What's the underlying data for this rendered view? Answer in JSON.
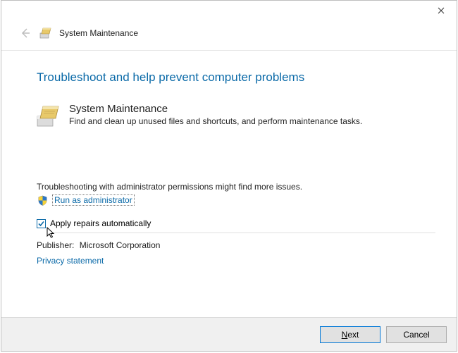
{
  "window": {
    "title": "System Maintenance"
  },
  "page": {
    "heading": "Troubleshoot and help prevent computer problems"
  },
  "troubleshooter": {
    "name": "System Maintenance",
    "description": "Find and clean up unused files and shortcuts, and perform maintenance tasks."
  },
  "admin": {
    "note": "Troubleshooting with administrator permissions might find more issues.",
    "link": "Run as administrator"
  },
  "options": {
    "apply_label": "Apply repairs automatically",
    "apply_checked": true
  },
  "meta": {
    "publisher_label": "Publisher:",
    "publisher_value": "Microsoft Corporation",
    "privacy": "Privacy statement"
  },
  "buttons": {
    "next_prefix": "N",
    "next_rest": "ext",
    "cancel": "Cancel"
  }
}
